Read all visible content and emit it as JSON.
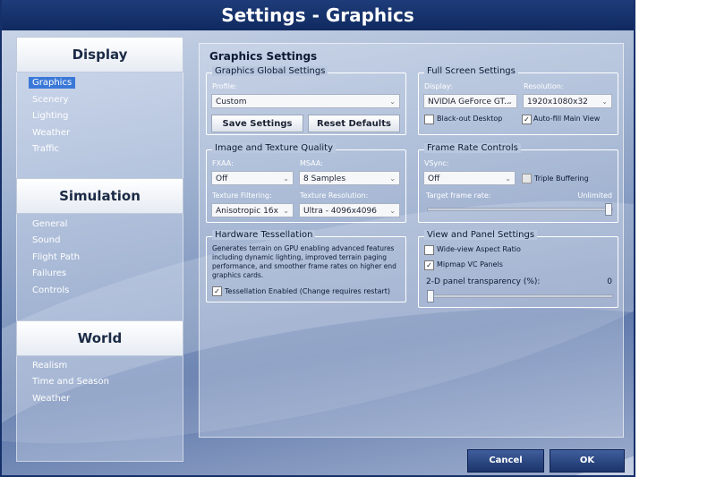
{
  "window": {
    "title": "Settings - Graphics"
  },
  "sidebar": {
    "sections": [
      {
        "title": "Display",
        "items": [
          "Graphics",
          "Scenery",
          "Lighting",
          "Weather",
          "Traffic"
        ]
      },
      {
        "title": "Simulation",
        "items": [
          "General",
          "Sound",
          "Flight Path",
          "Failures",
          "Controls"
        ]
      },
      {
        "title": "World",
        "items": [
          "Realism",
          "Time and Season",
          "Weather"
        ]
      }
    ],
    "active_item": "Graphics"
  },
  "main": {
    "title": "Graphics Settings",
    "global": {
      "label": "Graphics Global Settings",
      "profile_label": "Profile:",
      "profile_value": "Custom",
      "save_button": "Save Settings",
      "reset_button": "Reset Defaults"
    },
    "fullscreen": {
      "label": "Full Screen Settings",
      "display_label": "Display:",
      "display_value": "NVIDIA GeForce GT...",
      "resolution_label": "Resolution:",
      "resolution_value": "1920x1080x32",
      "blackout_label": "Black-out Desktop",
      "blackout_checked": false,
      "autofill_label": "Auto-fill Main View",
      "autofill_checked": true
    },
    "image_quality": {
      "label": "Image and Texture Quality",
      "fxaa_label": "FXAA:",
      "fxaa_value": "Off",
      "msaa_label": "MSAA:",
      "msaa_value": "8 Samples",
      "tex_filter_label": "Texture Filtering:",
      "tex_filter_value": "Anisotropic 16x",
      "tex_res_label": "Texture Resolution:",
      "tex_res_value": "Ultra - 4096x4096"
    },
    "framerate": {
      "label": "Frame Rate Controls",
      "vsync_label": "VSync:",
      "vsync_value": "Off",
      "triple_label": "Triple Buffering",
      "triple_checked": false,
      "target_label": "Target frame rate:",
      "target_value": "Unlimited",
      "target_fraction": 1.0
    },
    "tessellation": {
      "label": "Hardware Tessellation",
      "description": "Generates terrain on GPU enabling advanced features including dynamic lighting, improved terrain paging performance, and smoother frame rates on higher end graphics cards.",
      "enabled_label": "Tessellation Enabled (Change requires restart)",
      "enabled_checked": true
    },
    "view_panel": {
      "label": "View and Panel Settings",
      "wideview_label": "Wide-view Aspect Ratio",
      "wideview_checked": false,
      "mipmap_label": "Mipmap VC Panels",
      "mipmap_checked": true,
      "transparency_label": "2-D panel transparency (%):",
      "transparency_value": "0",
      "transparency_fraction": 0.0
    }
  },
  "footer": {
    "cancel": "Cancel",
    "ok": "OK"
  },
  "icons": {
    "check": "✓",
    "chevron": "⌄"
  }
}
